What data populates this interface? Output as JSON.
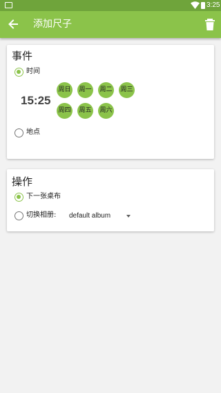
{
  "status_bar": {
    "time": "3:25"
  },
  "app_bar": {
    "title": "添加尺子"
  },
  "event_card": {
    "title": "事件",
    "time_option": {
      "label": "时间",
      "checked": true
    },
    "time_value": "15:25",
    "days": [
      "周日",
      "周一",
      "周二",
      "周三",
      "周四",
      "周五",
      "周六"
    ],
    "location_option": {
      "label": "地点",
      "checked": false
    }
  },
  "action_card": {
    "title": "操作",
    "next_option": {
      "label": "下一张桌布",
      "checked": true
    },
    "switch_option": {
      "label": "切换相册:",
      "checked": false
    },
    "album_select": {
      "value": "default album"
    }
  },
  "colors": {
    "accent": "#8bc34a",
    "status_bar": "#6fa43b",
    "background": "#f2f2f2"
  }
}
